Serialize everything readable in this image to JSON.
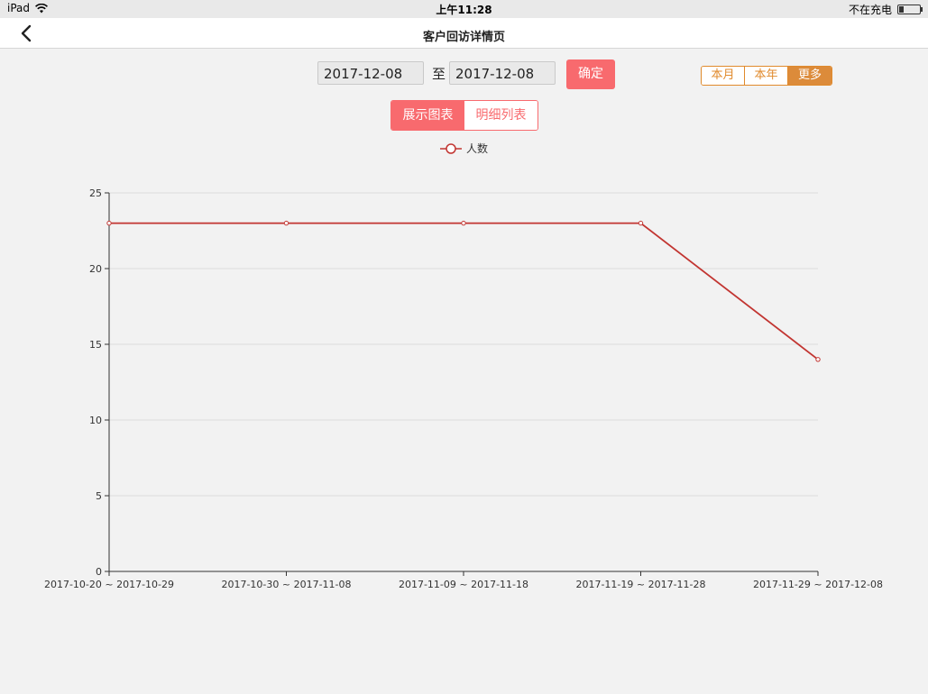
{
  "status_bar": {
    "device": "iPad",
    "time": "上午11:28",
    "battery_text": "不在充电"
  },
  "nav": {
    "title": "客户回访详情页"
  },
  "filter": {
    "start_date": "2017-12-08",
    "separator": "至",
    "end_date": "2017-12-08",
    "confirm_label": "确定"
  },
  "period": {
    "items": [
      {
        "label": "本月",
        "active": false
      },
      {
        "label": "本年",
        "active": false
      },
      {
        "label": "更多",
        "active": true
      }
    ]
  },
  "view_toggle": {
    "chart_label": "展示图表",
    "list_label": "明细列表",
    "active": "chart"
  },
  "colors": {
    "accent_red": "#f86a6e",
    "accent_orange": "#dc8b3a",
    "line": "#c23531"
  },
  "chart_data": {
    "type": "line",
    "categories": [
      "2017-10-20 ~ 2017-10-29",
      "2017-10-30 ~ 2017-11-08",
      "2017-11-09 ~ 2017-11-18",
      "2017-11-19 ~ 2017-11-28",
      "2017-11-29 ~ 2017-12-08"
    ],
    "series": [
      {
        "name": "人数",
        "values": [
          23,
          23,
          23,
          23,
          14
        ]
      }
    ],
    "yticks": [
      0,
      5,
      10,
      15,
      20,
      25
    ],
    "ylim": [
      0,
      25
    ],
    "grid": true,
    "legend": "top-center"
  }
}
